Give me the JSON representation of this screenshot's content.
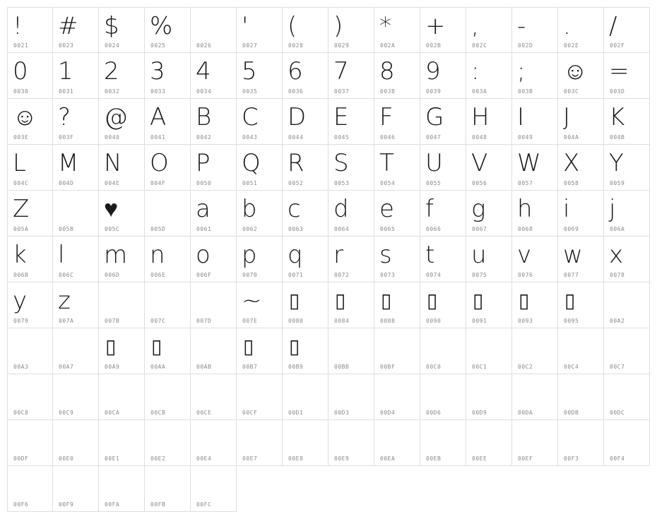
{
  "font_chart": {
    "missing_glyph": "▯",
    "cells": [
      {
        "glyph": "!",
        "code": "0021"
      },
      {
        "glyph": "#",
        "code": "0023"
      },
      {
        "glyph": "$",
        "code": "0024"
      },
      {
        "glyph": "%",
        "code": "0025"
      },
      {
        "glyph": "",
        "code": "0026"
      },
      {
        "glyph": "'",
        "code": "0027"
      },
      {
        "glyph": "(",
        "code": "0028"
      },
      {
        "glyph": ")",
        "code": "0029"
      },
      {
        "glyph": "*",
        "code": "002A"
      },
      {
        "glyph": "+",
        "code": "002B"
      },
      {
        "glyph": ",",
        "code": "002C"
      },
      {
        "glyph": "-",
        "code": "002D"
      },
      {
        "glyph": ".",
        "code": "002E"
      },
      {
        "glyph": "/",
        "code": "002F"
      },
      {
        "glyph": "0",
        "code": "0030"
      },
      {
        "glyph": "1",
        "code": "0031"
      },
      {
        "glyph": "2",
        "code": "0032"
      },
      {
        "glyph": "3",
        "code": "0033"
      },
      {
        "glyph": "4",
        "code": "0034"
      },
      {
        "glyph": "5",
        "code": "0035"
      },
      {
        "glyph": "6",
        "code": "0036"
      },
      {
        "glyph": "7",
        "code": "0037"
      },
      {
        "glyph": "8",
        "code": "0038"
      },
      {
        "glyph": "9",
        "code": "0039"
      },
      {
        "glyph": ":",
        "code": "003A"
      },
      {
        "glyph": ";",
        "code": "003B"
      },
      {
        "glyph": "☺",
        "code": "003C"
      },
      {
        "glyph": "=",
        "code": "003D"
      },
      {
        "glyph": "☺",
        "code": "003E"
      },
      {
        "glyph": "?",
        "code": "003F"
      },
      {
        "glyph": "@",
        "code": "0040"
      },
      {
        "glyph": "A",
        "code": "0041"
      },
      {
        "glyph": "B",
        "code": "0042"
      },
      {
        "glyph": "C",
        "code": "0043"
      },
      {
        "glyph": "D",
        "code": "0044"
      },
      {
        "glyph": "E",
        "code": "0045"
      },
      {
        "glyph": "F",
        "code": "0046"
      },
      {
        "glyph": "G",
        "code": "0047"
      },
      {
        "glyph": "H",
        "code": "0048"
      },
      {
        "glyph": "I",
        "code": "0049"
      },
      {
        "glyph": "J",
        "code": "004A"
      },
      {
        "glyph": "K",
        "code": "004B"
      },
      {
        "glyph": "L",
        "code": "004C"
      },
      {
        "glyph": "M",
        "code": "004D"
      },
      {
        "glyph": "N",
        "code": "004E"
      },
      {
        "glyph": "O",
        "code": "004F"
      },
      {
        "glyph": "P",
        "code": "0050"
      },
      {
        "glyph": "Q",
        "code": "0051"
      },
      {
        "glyph": "R",
        "code": "0052"
      },
      {
        "glyph": "S",
        "code": "0053"
      },
      {
        "glyph": "T",
        "code": "0054"
      },
      {
        "glyph": "U",
        "code": "0055"
      },
      {
        "glyph": "V",
        "code": "0056"
      },
      {
        "glyph": "W",
        "code": "0057"
      },
      {
        "glyph": "X",
        "code": "0058"
      },
      {
        "glyph": "Y",
        "code": "0059"
      },
      {
        "glyph": "Z",
        "code": "005A"
      },
      {
        "glyph": "",
        "code": "005B"
      },
      {
        "glyph": "♥",
        "code": "005C"
      },
      {
        "glyph": "",
        "code": "005D"
      },
      {
        "glyph": "a",
        "code": "0061"
      },
      {
        "glyph": "b",
        "code": "0062"
      },
      {
        "glyph": "c",
        "code": "0063"
      },
      {
        "glyph": "d",
        "code": "0064"
      },
      {
        "glyph": "e",
        "code": "0065"
      },
      {
        "glyph": "f",
        "code": "0066"
      },
      {
        "glyph": "g",
        "code": "0067"
      },
      {
        "glyph": "h",
        "code": "0068"
      },
      {
        "glyph": "i",
        "code": "0069"
      },
      {
        "glyph": "j",
        "code": "006A"
      },
      {
        "glyph": "k",
        "code": "006B"
      },
      {
        "glyph": "l",
        "code": "006C"
      },
      {
        "glyph": "m",
        "code": "006D"
      },
      {
        "glyph": "n",
        "code": "006E"
      },
      {
        "glyph": "o",
        "code": "006F"
      },
      {
        "glyph": "p",
        "code": "0070"
      },
      {
        "glyph": "q",
        "code": "0071"
      },
      {
        "glyph": "r",
        "code": "0072"
      },
      {
        "glyph": "s",
        "code": "0073"
      },
      {
        "glyph": "t",
        "code": "0074"
      },
      {
        "glyph": "u",
        "code": "0075"
      },
      {
        "glyph": "v",
        "code": "0076"
      },
      {
        "glyph": "w",
        "code": "0077"
      },
      {
        "glyph": "x",
        "code": "0078"
      },
      {
        "glyph": "y",
        "code": "0079"
      },
      {
        "glyph": "z",
        "code": "007A"
      },
      {
        "glyph": "",
        "code": "007B"
      },
      {
        "glyph": "",
        "code": "007C"
      },
      {
        "glyph": "",
        "code": "007D"
      },
      {
        "glyph": "~",
        "code": "007E"
      },
      {
        "glyph": "▯",
        "code": "0080"
      },
      {
        "glyph": "▯",
        "code": "0084"
      },
      {
        "glyph": "▯",
        "code": "0088"
      },
      {
        "glyph": "▯",
        "code": "0090"
      },
      {
        "glyph": "▯",
        "code": "0091"
      },
      {
        "glyph": "▯",
        "code": "0093"
      },
      {
        "glyph": "▯",
        "code": "0095"
      },
      {
        "glyph": "",
        "code": "00A2"
      },
      {
        "glyph": "",
        "code": "00A3"
      },
      {
        "glyph": "",
        "code": "00A7"
      },
      {
        "glyph": "▯",
        "code": "00A9"
      },
      {
        "glyph": "▯",
        "code": "00AA"
      },
      {
        "glyph": "",
        "code": "00AB"
      },
      {
        "glyph": "▯",
        "code": "00B7"
      },
      {
        "glyph": "▯",
        "code": "00B9"
      },
      {
        "glyph": "",
        "code": "00BB"
      },
      {
        "glyph": "",
        "code": "00BF"
      },
      {
        "glyph": "",
        "code": "00C0"
      },
      {
        "glyph": "",
        "code": "00C1"
      },
      {
        "glyph": "",
        "code": "00C2"
      },
      {
        "glyph": "",
        "code": "00C4"
      },
      {
        "glyph": "",
        "code": "00C7"
      },
      {
        "glyph": "",
        "code": "00C8"
      },
      {
        "glyph": "",
        "code": "00C9"
      },
      {
        "glyph": "",
        "code": "00CA"
      },
      {
        "glyph": "",
        "code": "00CB"
      },
      {
        "glyph": "",
        "code": "00CE"
      },
      {
        "glyph": "",
        "code": "00CF"
      },
      {
        "glyph": "",
        "code": "00D1"
      },
      {
        "glyph": "",
        "code": "00D3"
      },
      {
        "glyph": "",
        "code": "00D4"
      },
      {
        "glyph": "",
        "code": "00D6"
      },
      {
        "glyph": "",
        "code": "00D9"
      },
      {
        "glyph": "",
        "code": "00DA"
      },
      {
        "glyph": "",
        "code": "00DB"
      },
      {
        "glyph": "",
        "code": "00DC"
      },
      {
        "glyph": "",
        "code": "00DF"
      },
      {
        "glyph": "",
        "code": "00E0"
      },
      {
        "glyph": "",
        "code": "00E1"
      },
      {
        "glyph": "",
        "code": "00E2"
      },
      {
        "glyph": "",
        "code": "00E4"
      },
      {
        "glyph": "",
        "code": "00E7"
      },
      {
        "glyph": "",
        "code": "00E8"
      },
      {
        "glyph": "",
        "code": "00E9"
      },
      {
        "glyph": "",
        "code": "00EA"
      },
      {
        "glyph": "",
        "code": "00EB"
      },
      {
        "glyph": "",
        "code": "00EE"
      },
      {
        "glyph": "",
        "code": "00EF"
      },
      {
        "glyph": "",
        "code": "00F3"
      },
      {
        "glyph": "",
        "code": "00F4"
      },
      {
        "glyph": "",
        "code": "00F6"
      },
      {
        "glyph": "",
        "code": "00F9"
      },
      {
        "glyph": "",
        "code": "00FA"
      },
      {
        "glyph": "",
        "code": "00FB"
      },
      {
        "glyph": "",
        "code": "00FC"
      }
    ]
  }
}
